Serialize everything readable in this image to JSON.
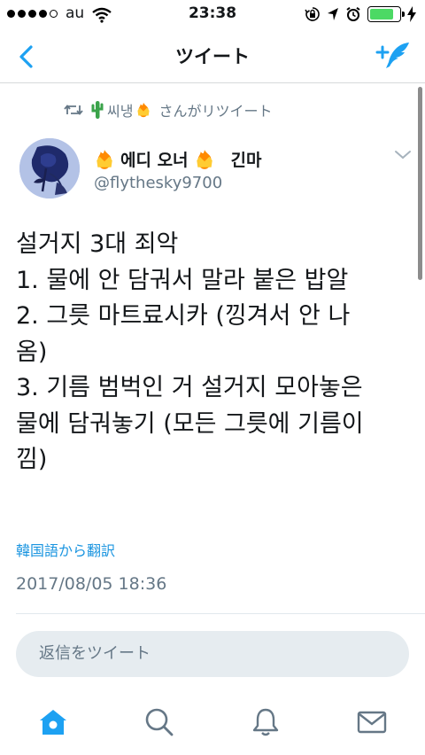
{
  "status_bar": {
    "carrier": "au",
    "time": "23:38",
    "battery_level": 0.8,
    "battery_color": "#4cd964"
  },
  "nav": {
    "title": "ツイート",
    "back_icon": "chevron-left-icon",
    "compose_icon": "compose-tweet-icon",
    "accent_color": "#1da1f2"
  },
  "tweet": {
    "retweeted_by": "씨냉",
    "retweeted_suffix": "さんがリツイート",
    "display_name": "에디 오너",
    "display_name_extra": "긴마",
    "handle": "@flythesky9700",
    "lines": [
      "설거지 3대 죄악",
      "1. 물에 안 담궈서 말라 붙은 밥알",
      "2. 그릇 마트료시카 (낑겨서 안 나",
      "옴)",
      "3. 기름 범벅인 거 설거지 모아놓은",
      "물에 담궈놓기 (모든 그릇에 기름이",
      "낌)"
    ],
    "translate_label": "韓国語から翻訳",
    "timestamp": "2017/08/05 18:36"
  },
  "reply": {
    "placeholder": "返信をツイート"
  },
  "tabbar": {
    "items": [
      {
        "icon": "home-icon",
        "active": true
      },
      {
        "icon": "search-icon",
        "active": false
      },
      {
        "icon": "notifications-icon",
        "active": false
      },
      {
        "icon": "messages-icon",
        "active": false
      }
    ]
  }
}
